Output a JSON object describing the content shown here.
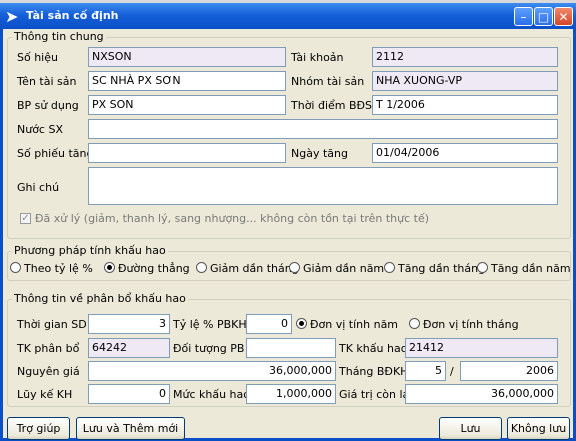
{
  "window": {
    "title": "Tài sản cố định"
  },
  "general": {
    "title": "Thông tin chung",
    "so_hieu": {
      "label": "Số hiệu",
      "value": "NXSON"
    },
    "tai_khoan": {
      "label": "Tài khoản",
      "value": "2112"
    },
    "ten_tai_san": {
      "label": "Tên tài sản",
      "value": "SC NHÀ PX SƠN"
    },
    "nhom_tai_san": {
      "label": "Nhóm tài sản",
      "value": "NHA XUONG-VP"
    },
    "bp_su_dung": {
      "label": "BP sử dụng",
      "value": "PX SON"
    },
    "thoi_diem": {
      "label": "Thời điểm BĐSD",
      "value": "T 1/2006"
    },
    "nuoc_sx": {
      "label": "Nước SX",
      "value": ""
    },
    "so_phieu_tang": {
      "label": "Số phiếu tăng",
      "value": ""
    },
    "ngay_tang": {
      "label": "Ngày tăng",
      "value": "01/04/2006"
    },
    "ghi_chu": {
      "label": "Ghi chú",
      "value": ""
    },
    "processed": {
      "checked": true,
      "label": "Đã xử lý (giảm, thanh lý, sang nhượng... không còn tồn tại trên thực tế)"
    }
  },
  "method": {
    "title": "Phương pháp tính khấu hao",
    "options": [
      {
        "label": "Theo tỷ lệ %",
        "selected": false
      },
      {
        "label": "Đường thẳng",
        "selected": true
      },
      {
        "label": "Giảm dần tháng",
        "selected": false
      },
      {
        "label": "Giảm dần năm",
        "selected": false
      },
      {
        "label": "Tăng dần tháng",
        "selected": false
      },
      {
        "label": "Tăng dần năm",
        "selected": false
      }
    ]
  },
  "allocation": {
    "title": "Thông tin về phân bổ khấu hao",
    "thoi_gian_sd": {
      "label": "Thời gian SD",
      "value": "3"
    },
    "ty_le_pbkh": {
      "label": "Tỷ lệ % PBKH",
      "value": "0"
    },
    "unit_year": {
      "label": "Đơn vị tính năm",
      "selected": true
    },
    "unit_month": {
      "label": "Đơn vị tính tháng",
      "selected": false
    },
    "tk_phan_bo": {
      "label": "TK phân bổ",
      "value": "64242"
    },
    "doi_tuong_pb": {
      "label": "Đối tượng PB",
      "value": ""
    },
    "tk_khau_hao": {
      "label": "TK khấu hao",
      "value": "21412"
    },
    "nguyen_gia": {
      "label": "Nguyên giá",
      "value": "36,000,000"
    },
    "thang_bdkh": {
      "label": "Tháng BĐKH",
      "month": "5",
      "separator": "/",
      "year": "2006"
    },
    "luy_ke_kh": {
      "label": "Lũy kế KH",
      "value": "0"
    },
    "muc_khau_hao": {
      "label": "Mức khấu hao",
      "value": "1,000,000"
    },
    "gia_tri_con_lai": {
      "label": "Giá trị còn lại",
      "value": "36,000,000"
    }
  },
  "buttons": {
    "help": "Trợ giúp",
    "save_add": "Lưu và Thêm mới",
    "save": "Lưu",
    "no_save": "Không lưu"
  },
  "colors": {
    "titlebar": "#0a4fc8",
    "dialog": "#ece9d8",
    "readonly_field": "#efe8f5"
  }
}
